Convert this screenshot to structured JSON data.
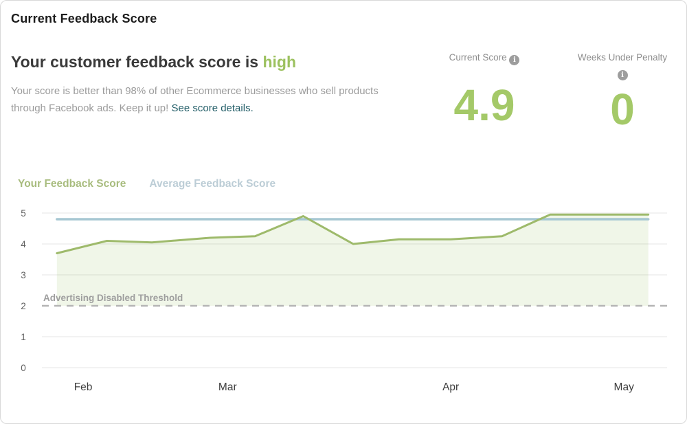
{
  "header": {
    "title": "Current Feedback Score"
  },
  "summary": {
    "heading_prefix": "Your customer feedback score is ",
    "heading_highlight": "high",
    "description": "Your score is better than 98% of other Ecommerce businesses who sell products through Facebook ads. Keep it up! ",
    "link_text": "See score details.",
    "info_icon_glyph": "i",
    "stats": [
      {
        "label": "Current Score",
        "value": "4.9"
      },
      {
        "label": "Weeks Under Penalty",
        "value": "0"
      }
    ]
  },
  "legend": {
    "your_score": "Your Feedback Score",
    "average_score": "Average Feedback Score"
  },
  "colors": {
    "accent_green": "#a4c968",
    "highlight_green": "#9cc15f",
    "legend_green": "#a8bc7e",
    "legend_blue": "#bccdd6",
    "line_green": "#9eba6b",
    "area_green_fill": "rgba(160, 198, 110, 0.16)",
    "average_line_blue": "#a6c7d2",
    "threshold_gray": "#b5b5b5",
    "link_teal": "#235e68",
    "gridline": "#eeeeee",
    "axis_text": "#5f5f5f",
    "month_text": "#3d3d3d"
  },
  "chart_data": {
    "type": "line",
    "title": "",
    "xlabel": "",
    "ylabel": "",
    "ylim": [
      0,
      5
    ],
    "yticks": [
      0,
      1,
      2,
      3,
      4,
      5
    ],
    "grid": true,
    "legend_position": "top-left",
    "x_axis_months": [
      {
        "label": "Feb",
        "pos": 0.066
      },
      {
        "label": "Mar",
        "pos": 0.297
      },
      {
        "label": "Apr",
        "pos": 0.654
      },
      {
        "label": "May",
        "pos": 0.931
      }
    ],
    "series": [
      {
        "name": "Your Feedback Score",
        "style": "area-line",
        "points": [
          [
            0.024,
            3.7
          ],
          [
            0.104,
            4.1
          ],
          [
            0.176,
            4.05
          ],
          [
            0.269,
            4.2
          ],
          [
            0.341,
            4.25
          ],
          [
            0.418,
            4.9
          ],
          [
            0.498,
            4.0
          ],
          [
            0.571,
            4.15
          ],
          [
            0.654,
            4.15
          ],
          [
            0.736,
            4.25
          ],
          [
            0.813,
            4.95
          ],
          [
            0.97,
            4.95
          ]
        ]
      },
      {
        "name": "Average Feedback Score",
        "style": "flat-line",
        "points": [
          [
            0.024,
            4.8
          ],
          [
            0.97,
            4.8
          ]
        ]
      }
    ],
    "threshold": {
      "value": 2,
      "label": "Advertising Disabled Threshold"
    }
  }
}
